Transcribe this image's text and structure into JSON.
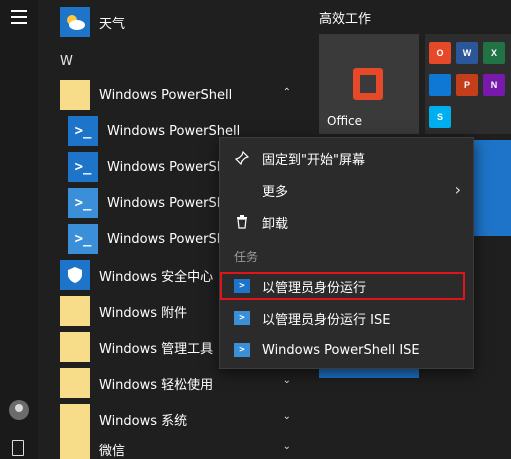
{
  "rail": {
    "menu_icon": "hamburger-icon",
    "user_icon": "user-avatar-icon",
    "doc_icon": "document-icon"
  },
  "app_list": {
    "weather_label": "天气",
    "section_letter": "W",
    "items": [
      {
        "label": "Windows PowerShell",
        "icon": "folder-icon",
        "expanded": true
      },
      {
        "label": "Windows PowerShell",
        "icon": "powershell-icon"
      },
      {
        "label": "Windows PowerShell",
        "icon": "powershell-icon"
      },
      {
        "label": "Windows PowerShell",
        "icon": "powershell-ise-icon"
      },
      {
        "label": "Windows PowerShell",
        "icon": "powershell-ise-icon"
      },
      {
        "label": "Windows 安全中心",
        "icon": "shield-icon"
      },
      {
        "label": "Windows 附件",
        "icon": "folder-icon"
      },
      {
        "label": "Windows 管理工具",
        "icon": "folder-icon"
      },
      {
        "label": "Windows 轻松使用",
        "icon": "folder-icon"
      },
      {
        "label": "Windows 系统",
        "icon": "folder-icon"
      },
      {
        "label": "微信",
        "icon": "folder-icon"
      }
    ]
  },
  "tiles": {
    "heading": "高效工作",
    "office_label": "Office",
    "mini_apps": [
      "O",
      "W",
      "X",
      "",
      "P",
      "N",
      "S"
    ]
  },
  "context_menu": {
    "pin_label": "固定到\"开始\"屏幕",
    "more_label": "更多",
    "uninstall_label": "卸载",
    "section_label": "任务",
    "run_as_admin_label": "以管理员身份运行",
    "run_ise_admin_label": "以管理员身份运行 ISE",
    "ise_label": "Windows PowerShell ISE"
  },
  "colors": {
    "accent": "#1e74c8",
    "highlight_border": "#e0141b",
    "office_red": "#e5492a"
  }
}
